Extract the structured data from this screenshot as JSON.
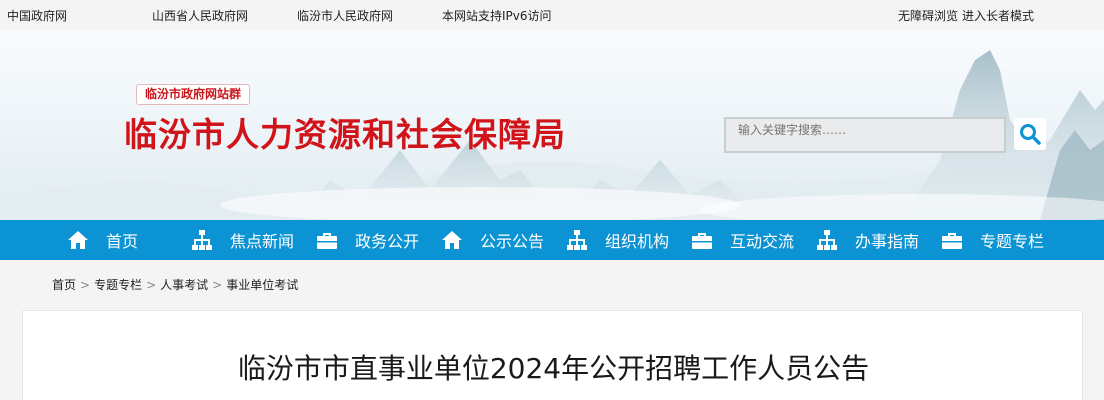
{
  "topbar": {
    "links": [
      "中国政府网",
      "山西省人民政府网",
      "临汾市人民政府网",
      "本网站支持IPv6访问"
    ],
    "accessibility": "无障碍浏览",
    "elder_mode": "进入长者模式"
  },
  "header": {
    "site_group": "临汾市政府网站群",
    "site_title": "临汾市人力资源和社会保障局",
    "search_placeholder": "输入关键字搜索……"
  },
  "nav": [
    {
      "label": "首页",
      "icon": "home-icon"
    },
    {
      "label": "焦点新闻",
      "icon": "org-chart-icon"
    },
    {
      "label": "政务公开",
      "icon": "briefcase-icon"
    },
    {
      "label": "公示公告",
      "icon": "home-icon"
    },
    {
      "label": "组织机构",
      "icon": "org-chart-icon"
    },
    {
      "label": "互动交流",
      "icon": "briefcase-icon"
    },
    {
      "label": "办事指南",
      "icon": "org-chart-icon"
    },
    {
      "label": "专题专栏",
      "icon": "briefcase-icon"
    }
  ],
  "breadcrumb": [
    "首页",
    "专题专栏",
    "人事考试",
    "事业单位考试"
  ],
  "article": {
    "title": "临汾市市直事业单位2024年公开招聘工作人员公告"
  },
  "colors": {
    "nav_bg": "#0c93d3",
    "title_red": "#d0141a"
  }
}
